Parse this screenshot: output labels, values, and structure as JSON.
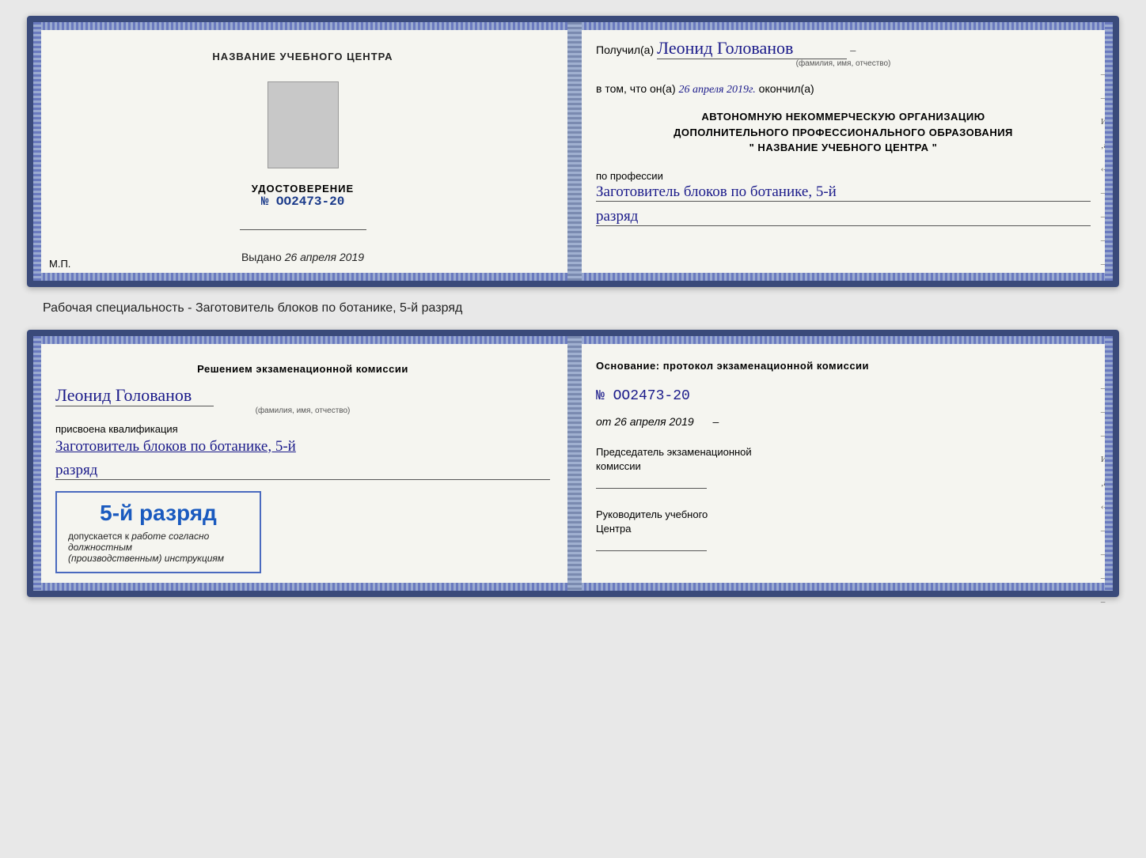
{
  "top_doc": {
    "left": {
      "title": "НАЗВАНИЕ УЧЕБНОГО ЦЕНТРА",
      "udostoverenie_label": "УДОСТОВЕРЕНИЕ",
      "number": "№ OO2473-20",
      "vydano_label": "Выдано",
      "vydano_date": "26 апреля 2019",
      "mp_label": "М.П."
    },
    "right": {
      "poluchil_prefix": "Получил(а)",
      "full_name": "Леонид Голованов",
      "fio_small": "(фамилия, имя, отчество)",
      "vtom_prefix": "в том, что он(а)",
      "date_handwritten": "26 апреля 2019г.",
      "okonchil": "окончил(а)",
      "org_line1": "АВТОНОМНУЮ НЕКОММЕРЧЕСКУЮ ОРГАНИЗАЦИЮ",
      "org_line2": "ДОПОЛНИТЕЛЬНОГО ПРОФЕССИОНАЛЬНОГО ОБРАЗОВАНИЯ",
      "org_line3": "\"  НАЗВАНИЕ УЧЕБНОГО ЦЕНТРА  \"",
      "po_professii": "по профессии",
      "profession": "Заготовитель блоков по ботанике, 5-й",
      "razryad": "разряд"
    }
  },
  "subtitle": "Рабочая специальность - Заготовитель блоков по ботанике, 5-й разряд",
  "bottom_doc": {
    "left": {
      "resheniyem": "Решением экзаменационной комиссии",
      "full_name": "Леонид Голованов",
      "fio_small": "(фамилия, имя, отчество)",
      "prisvoena": "присвоена квалификация",
      "qualification": "Заготовитель блоков по ботанике, 5-й",
      "razryad": "разряд",
      "stamp_rank": "5-й разряд",
      "dopuskaetsya": "допускается к",
      "work_text": "работе согласно должностным",
      "instructions": "(производственным) инструкциям"
    },
    "right": {
      "osnovanie": "Основание: протокол экзаменационной комиссии",
      "number": "№  OO2473-20",
      "ot_label": "от",
      "ot_date": "26 апреля 2019",
      "chairman_line1": "Председатель экзаменационной",
      "chairman_line2": "комиссии",
      "rukovoditel_line1": "Руководитель учебного",
      "rukovoditel_line2": "Центра"
    }
  }
}
